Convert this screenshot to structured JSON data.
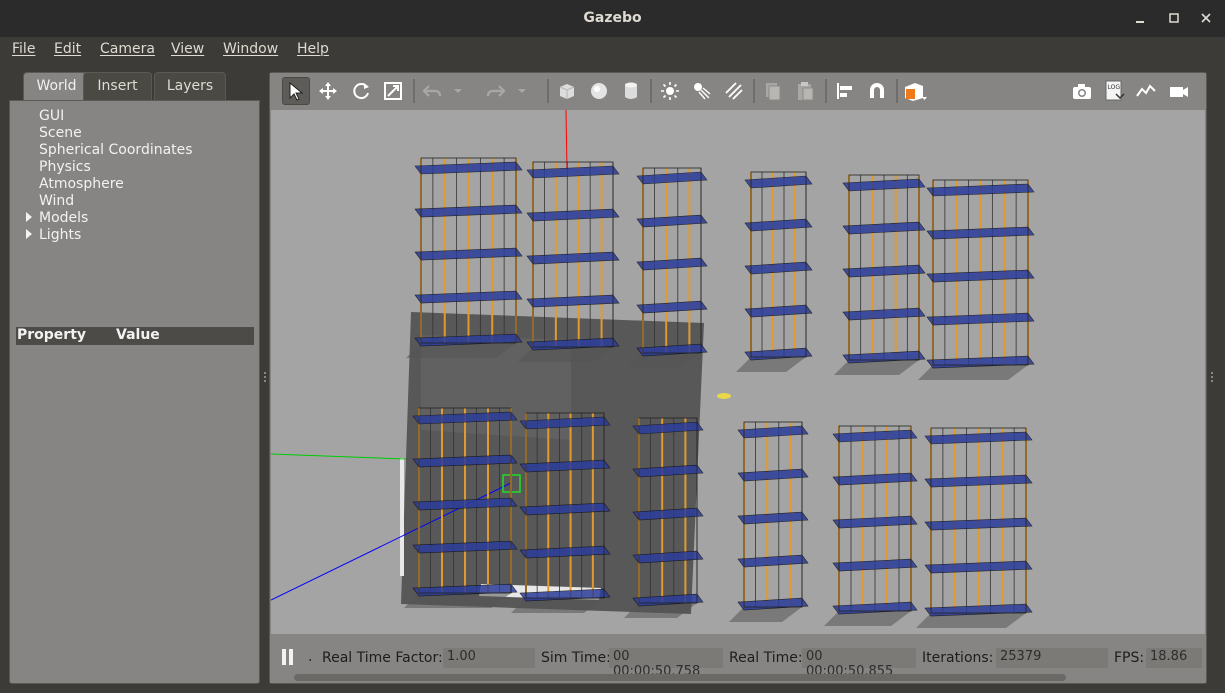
{
  "window": {
    "title": "Gazebo"
  },
  "menu": {
    "items": [
      "File",
      "Edit",
      "Camera",
      "View",
      "Window",
      "Help"
    ]
  },
  "left_panel": {
    "tabs": [
      "World",
      "Insert",
      "Layers"
    ],
    "active_tab": "World",
    "tree": [
      {
        "label": "GUI",
        "expandable": false
      },
      {
        "label": "Scene",
        "expandable": false
      },
      {
        "label": "Spherical Coordinates",
        "expandable": false
      },
      {
        "label": "Physics",
        "expandable": false
      },
      {
        "label": "Atmosphere",
        "expandable": false
      },
      {
        "label": "Wind",
        "expandable": false
      },
      {
        "label": "Models",
        "expandable": true
      },
      {
        "label": "Lights",
        "expandable": true
      }
    ],
    "property_header": {
      "property": "Property",
      "value": "Value"
    }
  },
  "toolbar": {
    "tools": [
      "select-mode",
      "translate-mode",
      "rotate-mode",
      "scale-mode",
      "undo",
      "undo-history",
      "redo",
      "redo-history",
      "box-shape",
      "sphere-shape",
      "cylinder-shape",
      "point-light",
      "spot-light",
      "directional-light",
      "copy",
      "paste",
      "align",
      "snap",
      "view-angle",
      "screenshot",
      "log",
      "plot",
      "record-video"
    ],
    "log_icon_text": "LOG"
  },
  "status": {
    "real_time_factor_label": "Real Time Factor:",
    "real_time_factor": "1.00",
    "sim_time_label": "Sim Time:",
    "sim_time": "00 00:00:50.758",
    "real_time_label": "Real Time:",
    "real_time": "00 00:00:50.855",
    "iterations_label": "Iterations:",
    "iterations": "25379",
    "fps_label": "FPS:",
    "fps": "18.86",
    "step_dot": "."
  },
  "colors": {
    "panel": "#868583",
    "viewport_bg": "#a4a4a4",
    "shelf_frame": "#e09a30",
    "shelf_deck": "#2b3c9a",
    "floor": "#555555",
    "axis_x": "#ff0000",
    "axis_y": "#00cc00",
    "axis_z": "#0000ff"
  }
}
